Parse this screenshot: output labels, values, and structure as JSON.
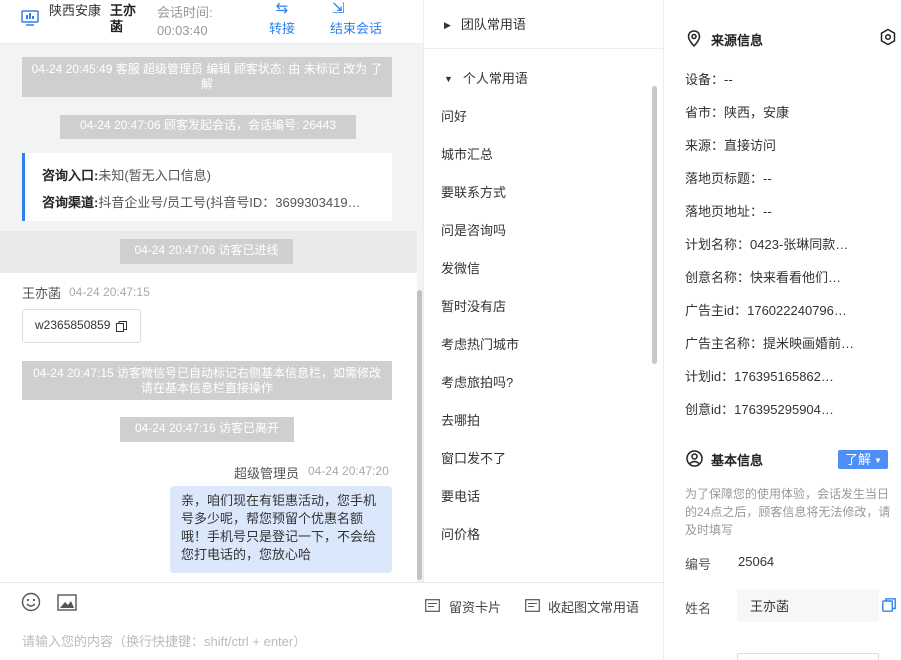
{
  "header": {
    "location": "陕西安康",
    "visitor_name": "王亦菡",
    "session_time_label": "会话时间:",
    "session_time": "00:03:40",
    "transfer_label": "转接",
    "end_label": "结束会话"
  },
  "messages": {
    "system": [
      "04-24 20:45:49 客服 超级管理员 编辑 顾客状态: 由 未标记 改为 了解",
      "04-24 20:47:06 顾客发起会话，会话编号: 26443",
      "04-24 20:47:06 访客已进线",
      "04-24 20:47:15 访客微信号已自动标记右侧基本信息栏，如需修改请在基本信息栏直接操作",
      "04-24 20:47:16 访客已离开"
    ],
    "entry_card": {
      "entry_label": "咨询入口:",
      "entry_value": "未知(暂无入口信息)",
      "channel_label": "咨询渠道:",
      "channel_value": "抖音企业号/员工号(抖音号ID：3699303419…"
    },
    "visitor": {
      "name": "王亦菡",
      "time": "04-24 20:47:15",
      "text": "w2365850859"
    },
    "agent": {
      "name": "超级管理员",
      "time": "04-24 20:47:20",
      "text": "亲，咱们现在有钜惠活动，您手机号多少呢，帮您预留个优惠名额哦！手机号只是登记一下，不会给您打电话的，您放心哈"
    }
  },
  "composer": {
    "card_label": "留资卡片",
    "fold_label": "收起图文常用语",
    "placeholder": "请输入您的内容（换行快捷键：shift/ctrl + enter）"
  },
  "phrases": {
    "team_label": "团队常用语",
    "personal_label": "个人常用语",
    "items": [
      "问好",
      "城市汇总",
      "要联系方式",
      "问是咨询吗",
      "发微信",
      "暂时没有店",
      "考虑热门城市",
      "考虑旅拍吗?",
      "去哪拍",
      "窗口发不了",
      "要电话",
      "问价格"
    ]
  },
  "source": {
    "title": "来源信息",
    "rows": [
      "设备：--",
      "省市：陕西，安康",
      "来源：直接访问",
      "落地页标题：--",
      "落地页地址：--",
      "计划名称：0423-张琳同款…",
      "创意名称：快来看看他们…",
      "广告主id：176022240796…",
      "广告主名称：提米映画婚前…",
      "计划id：176395165862…",
      "创意id：176395295904…"
    ]
  },
  "basic": {
    "title": "基本信息",
    "learn_label": "了解",
    "notice": "为了保障您的使用体验，会话发生当日的24点之后，顾客信息将无法修改，请及时填写",
    "id_label": "编号",
    "id_value": "25064",
    "name_label": "姓名",
    "name_value": "王亦菡"
  }
}
